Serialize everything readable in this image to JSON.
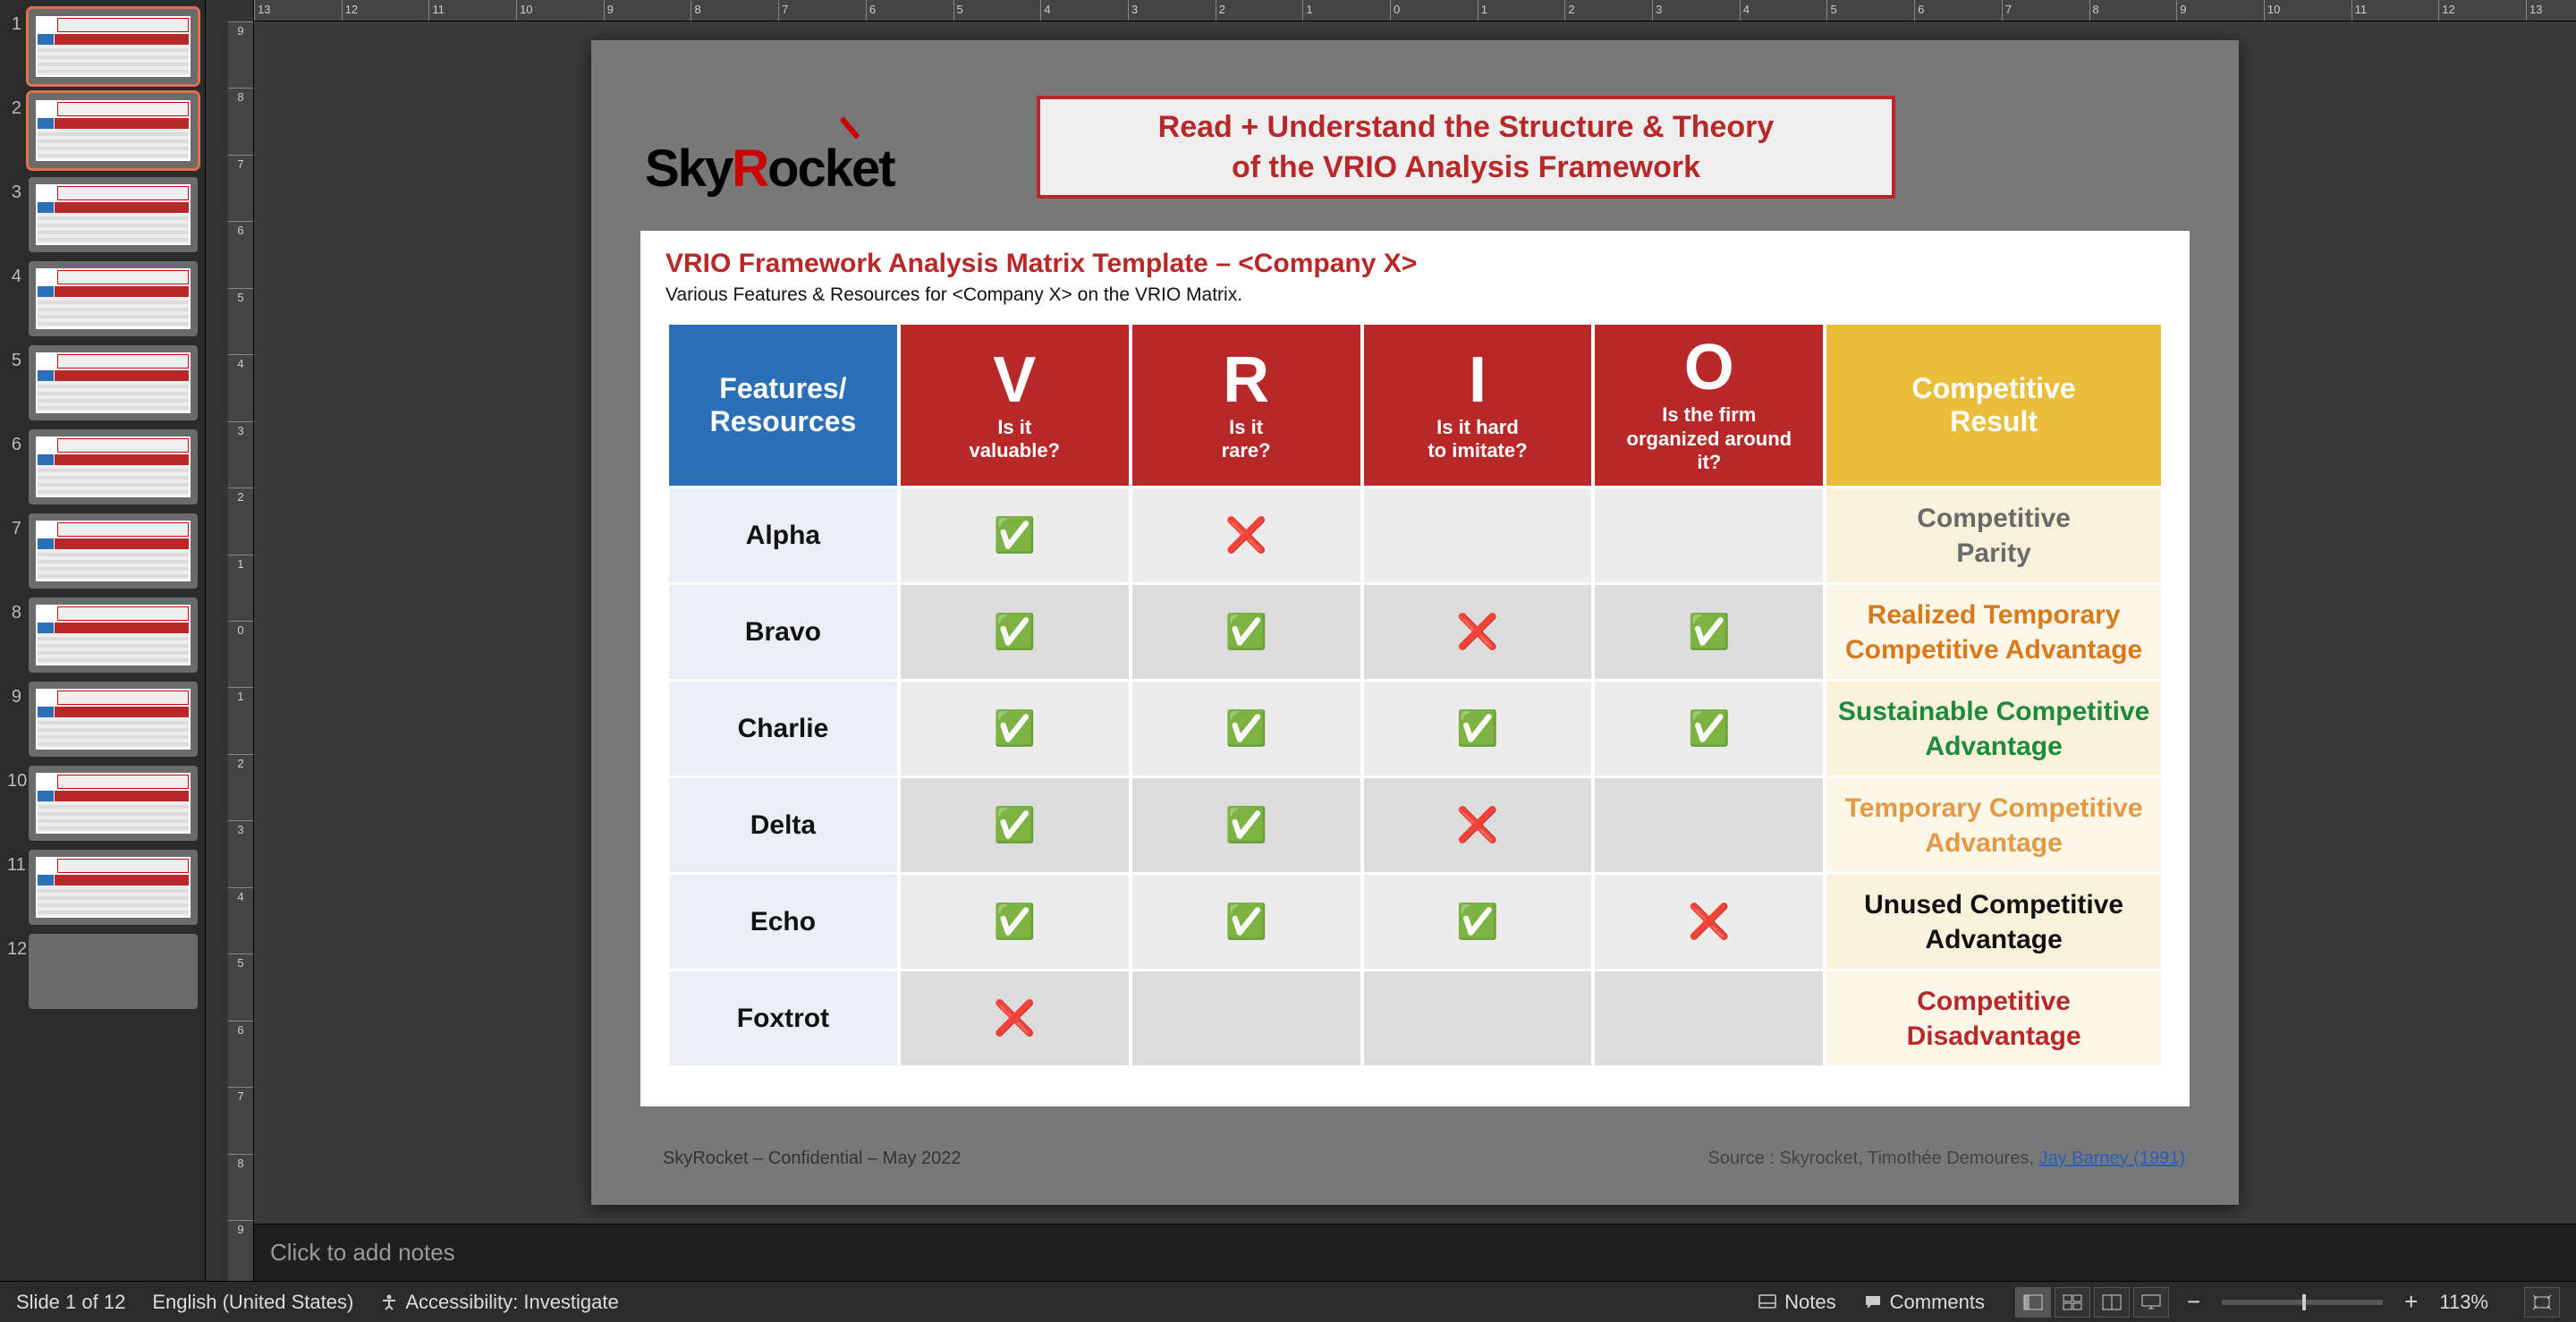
{
  "thumbnails": {
    "count": 12,
    "selected": [
      1,
      2
    ]
  },
  "ruler": {
    "h_ticks": [
      13,
      12,
      11,
      10,
      9,
      8,
      7,
      6,
      5,
      4,
      3,
      2,
      1,
      0,
      1,
      2,
      3,
      4,
      5,
      6,
      7,
      8,
      9,
      10,
      11,
      12,
      13
    ],
    "v_ticks": [
      9,
      8,
      7,
      6,
      5,
      4,
      3,
      2,
      1,
      0,
      1,
      2,
      3,
      4,
      5,
      6,
      7,
      8,
      9
    ]
  },
  "slide": {
    "logo_part1": "Sky",
    "logo_accent": "R",
    "logo_part2": "ocket",
    "banner_l1": "Read + Understand the Structure & Theory",
    "banner_l2": "of the VRIO Analysis Framework",
    "title": "VRIO Framework Analysis Matrix Template – <Company X>",
    "subtitle": "Various Features & Resources for <Company X> on the VRIO Matrix.",
    "headers": {
      "features": "Features/\nResources",
      "v": {
        "big": "V",
        "sub": "Is it\nvaluable?"
      },
      "r": {
        "big": "R",
        "sub": "Is it\nrare?"
      },
      "i": {
        "big": "I",
        "sub": "Is it hard\nto imitate?"
      },
      "o": {
        "big": "O",
        "sub": "Is the firm\norganized around\nit?"
      },
      "result": "Competitive\nResult"
    },
    "rows": [
      {
        "name": "Alpha",
        "v": "y",
        "r": "n",
        "i": "",
        "o": "",
        "result": "Competitive\nParity",
        "color": "#6a6a6a"
      },
      {
        "name": "Bravo",
        "v": "y",
        "r": "y",
        "i": "n",
        "o": "y",
        "result": "Realized Temporary\nCompetitive Advantage",
        "color": "#d97a1a"
      },
      {
        "name": "Charlie",
        "v": "y",
        "r": "y",
        "i": "y",
        "o": "y",
        "result": "Sustainable Competitive\nAdvantage",
        "color": "#1d8a3d"
      },
      {
        "name": "Delta",
        "v": "y",
        "r": "y",
        "i": "n",
        "o": "",
        "result": "Temporary Competitive\nAdvantage",
        "color": "#e39a45"
      },
      {
        "name": "Echo",
        "v": "y",
        "r": "y",
        "i": "y",
        "o": "n",
        "result": "Unused Competitive\nAdvantage",
        "color": "#111"
      },
      {
        "name": "Foxtrot",
        "v": "n",
        "r": "",
        "i": "",
        "o": "",
        "result": "Competitive\nDisadvantage",
        "color": "#b82828"
      }
    ],
    "footer_left": "SkyRocket – Confidential – May 2022",
    "footer_src_label": "Source : Skyrocket, Timothée Demoures,  ",
    "footer_src_link": "Jay Barney (1991)"
  },
  "notes": {
    "placeholder": "Click to add notes"
  },
  "status": {
    "slide_info": "Slide 1 of 12",
    "language": "English (United States)",
    "accessibility": "Accessibility: Investigate",
    "notes_btn": "Notes",
    "comments_btn": "Comments",
    "zoom_pct": "113%"
  },
  "marks": {
    "y": "✅",
    "n": "❌"
  }
}
